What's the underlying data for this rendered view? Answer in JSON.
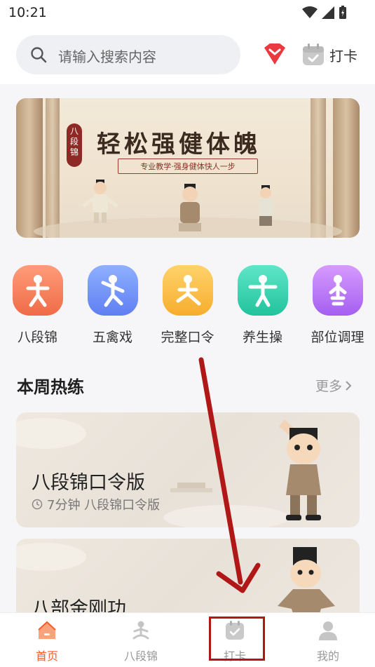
{
  "status_bar": {
    "time": "10:21"
  },
  "header": {
    "search_placeholder": "请输入搜索内容",
    "checkin_label": "打卡"
  },
  "banner": {
    "title": "轻松强健体魄",
    "subtitle": "专业教学·强身健体快人一步",
    "seal_text": "八段锦"
  },
  "categories": [
    {
      "label": "八段锦",
      "color_from": "#ff9c7a",
      "color_to": "#f06b47"
    },
    {
      "label": "五禽戏",
      "color_from": "#8fb0ff",
      "color_to": "#5f7ff2"
    },
    {
      "label": "完整口令",
      "color_from": "#ffd36b",
      "color_to": "#f7ad2e"
    },
    {
      "label": "养生操",
      "color_from": "#5fe6c8",
      "color_to": "#21c39c"
    },
    {
      "label": "部位调理",
      "color_from": "#d79bff",
      "color_to": "#a45ff0"
    }
  ],
  "section": {
    "title": "本周热练",
    "more_label": "更多"
  },
  "cards": [
    {
      "title": "八段锦口令版",
      "meta": "7分钟  八段锦口令版"
    },
    {
      "title": "八部金刚功"
    }
  ],
  "bottom_nav": [
    {
      "label": "首页",
      "icon": "home-icon",
      "active": true
    },
    {
      "label": "八段锦",
      "icon": "meditation-icon",
      "active": false
    },
    {
      "label": "打卡",
      "icon": "calendar-check-icon",
      "active": false
    },
    {
      "label": "我的",
      "icon": "user-icon",
      "active": false
    }
  ],
  "colors": {
    "accent": "#f25e2b",
    "annotation": "#b01818"
  }
}
